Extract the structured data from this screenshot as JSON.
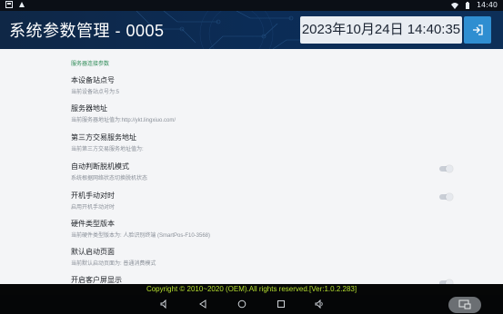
{
  "status_bar": {
    "time": "14:40",
    "icons_left": [
      "notification-square-icon",
      "app-icon"
    ],
    "icons_right": [
      "wifi-icon",
      "battery-icon"
    ]
  },
  "header": {
    "title": "系统参数管理 - 0005",
    "datetime": "2023年10月24日 14:40:35",
    "exit_icon": "exit-icon",
    "colors": {
      "bar": "#0f2746",
      "datetime_bg": "#e9edf2",
      "exit_button": "#2f8ed1"
    }
  },
  "settings": {
    "section_title": "服务器连接参数",
    "items": [
      {
        "label": "本设备站点号",
        "desc": "当前设备站点号为:5"
      },
      {
        "label": "服务器地址",
        "desc": "当前服务器地址值为:http://ykt.lingxiuo.com/"
      },
      {
        "label": "第三方交易服务地址",
        "desc": "当前第三方交易服务地址值为:"
      },
      {
        "label": "自动判断脱机模式",
        "desc": "系统根据网络状态切换脱机状态",
        "toggle": false
      },
      {
        "label": "开机手动对时",
        "desc": "启用开机手动对时",
        "toggle": false
      },
      {
        "label": "硬件类型版本",
        "desc": "当前硬件类型版本为: 人脸识别终端 (SmartPos-F10-3568)"
      },
      {
        "label": "默认启动页面",
        "desc": "当前默认启动页面为: 普通消费模式"
      },
      {
        "label": "开启客户屏显示",
        "desc": "",
        "toggle": false
      }
    ]
  },
  "footer": {
    "copyright": "Copyright © 2010~2020 (OEM).All rights reserved.[Ver:1.0.2.283]",
    "copyright_color": "#b6e02f"
  },
  "nav_bar": {
    "icons": [
      "volume-down-icon",
      "back-icon",
      "home-icon",
      "recents-icon",
      "volume-up-icon",
      "floating-window-icon"
    ]
  }
}
